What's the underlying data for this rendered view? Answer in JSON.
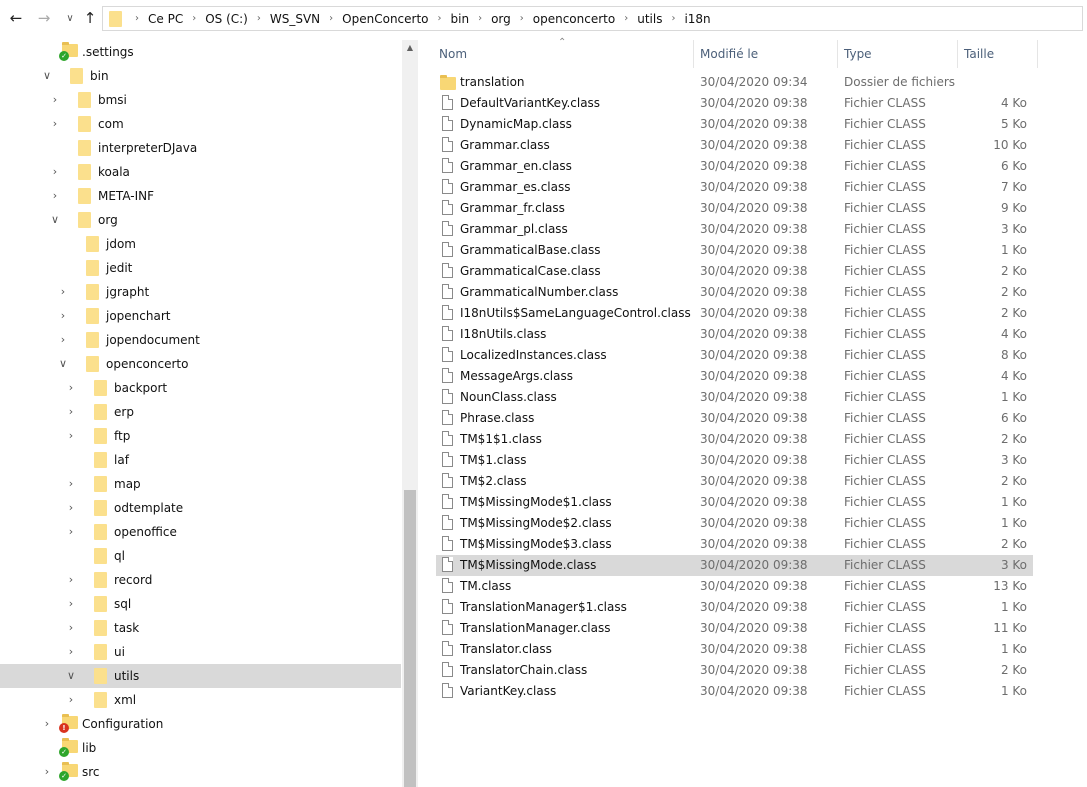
{
  "address": {
    "crumbs": [
      "Ce PC",
      "OS (C:)",
      "WS_SVN",
      "OpenConcerto",
      "bin",
      "org",
      "openconcerto",
      "utils",
      "i18n"
    ]
  },
  "columns": {
    "name": "Nom",
    "date": "Modifié le",
    "type": "Type",
    "size": "Taille"
  },
  "tree": [
    {
      "label": ".settings",
      "level": 0,
      "chevron": "",
      "icon": "folder",
      "badge": "ok"
    },
    {
      "label": "bin",
      "level": 0,
      "chevron": "down",
      "icon": "folder-tall",
      "badge": ""
    },
    {
      "label": "bmsi",
      "level": 1,
      "chevron": "right",
      "icon": "folder-tall",
      "badge": ""
    },
    {
      "label": "com",
      "level": 1,
      "chevron": "right",
      "icon": "folder-tall",
      "badge": ""
    },
    {
      "label": "interpreterDJava",
      "level": 1,
      "chevron": "",
      "icon": "folder-tall",
      "badge": ""
    },
    {
      "label": "koala",
      "level": 1,
      "chevron": "right",
      "icon": "folder-tall",
      "badge": ""
    },
    {
      "label": "META-INF",
      "level": 1,
      "chevron": "right",
      "icon": "folder-tall",
      "badge": ""
    },
    {
      "label": "org",
      "level": 1,
      "chevron": "down",
      "icon": "folder-tall",
      "badge": ""
    },
    {
      "label": "jdom",
      "level": 2,
      "chevron": "",
      "icon": "folder-tall",
      "badge": ""
    },
    {
      "label": "jedit",
      "level": 2,
      "chevron": "",
      "icon": "folder-tall",
      "badge": ""
    },
    {
      "label": "jgrapht",
      "level": 2,
      "chevron": "right",
      "icon": "folder-tall",
      "badge": ""
    },
    {
      "label": "jopenchart",
      "level": 2,
      "chevron": "right",
      "icon": "folder-tall",
      "badge": ""
    },
    {
      "label": "jopendocument",
      "level": 2,
      "chevron": "right",
      "icon": "folder-tall",
      "badge": ""
    },
    {
      "label": "openconcerto",
      "level": 2,
      "chevron": "down",
      "icon": "folder-tall",
      "badge": ""
    },
    {
      "label": "backport",
      "level": 3,
      "chevron": "right",
      "icon": "folder-tall",
      "badge": ""
    },
    {
      "label": "erp",
      "level": 3,
      "chevron": "right",
      "icon": "folder-tall",
      "badge": ""
    },
    {
      "label": "ftp",
      "level": 3,
      "chevron": "right",
      "icon": "folder-tall",
      "badge": ""
    },
    {
      "label": "laf",
      "level": 3,
      "chevron": "",
      "icon": "folder-tall",
      "badge": ""
    },
    {
      "label": "map",
      "level": 3,
      "chevron": "right",
      "icon": "folder-tall",
      "badge": ""
    },
    {
      "label": "odtemplate",
      "level": 3,
      "chevron": "right",
      "icon": "folder-tall",
      "badge": ""
    },
    {
      "label": "openoffice",
      "level": 3,
      "chevron": "right",
      "icon": "folder-tall",
      "badge": ""
    },
    {
      "label": "ql",
      "level": 3,
      "chevron": "",
      "icon": "folder-tall",
      "badge": ""
    },
    {
      "label": "record",
      "level": 3,
      "chevron": "right",
      "icon": "folder-tall",
      "badge": ""
    },
    {
      "label": "sql",
      "level": 3,
      "chevron": "right",
      "icon": "folder-tall",
      "badge": ""
    },
    {
      "label": "task",
      "level": 3,
      "chevron": "right",
      "icon": "folder-tall",
      "badge": ""
    },
    {
      "label": "ui",
      "level": 3,
      "chevron": "right",
      "icon": "folder-tall",
      "badge": ""
    },
    {
      "label": "utils",
      "level": 3,
      "chevron": "down",
      "icon": "folder-tall",
      "badge": "",
      "selected": true
    },
    {
      "label": "xml",
      "level": 3,
      "chevron": "right",
      "icon": "folder-tall",
      "badge": ""
    },
    {
      "label": "Configuration",
      "level": 0,
      "chevron": "right",
      "icon": "folder",
      "badge": "err"
    },
    {
      "label": "lib",
      "level": 0,
      "chevron": "",
      "icon": "folder",
      "badge": "ok"
    },
    {
      "label": "src",
      "level": 0,
      "chevron": "right",
      "icon": "folder",
      "badge": "ok"
    }
  ],
  "files": [
    {
      "name": "translation",
      "date": "30/04/2020 09:34",
      "type": "Dossier de fichiers",
      "size": "",
      "kind": "folder"
    },
    {
      "name": "DefaultVariantKey.class",
      "date": "30/04/2020 09:38",
      "type": "Fichier CLASS",
      "size": "4 Ko",
      "kind": "file"
    },
    {
      "name": "DynamicMap.class",
      "date": "30/04/2020 09:38",
      "type": "Fichier CLASS",
      "size": "5 Ko",
      "kind": "file"
    },
    {
      "name": "Grammar.class",
      "date": "30/04/2020 09:38",
      "type": "Fichier CLASS",
      "size": "10 Ko",
      "kind": "file"
    },
    {
      "name": "Grammar_en.class",
      "date": "30/04/2020 09:38",
      "type": "Fichier CLASS",
      "size": "6 Ko",
      "kind": "file"
    },
    {
      "name": "Grammar_es.class",
      "date": "30/04/2020 09:38",
      "type": "Fichier CLASS",
      "size": "7 Ko",
      "kind": "file"
    },
    {
      "name": "Grammar_fr.class",
      "date": "30/04/2020 09:38",
      "type": "Fichier CLASS",
      "size": "9 Ko",
      "kind": "file"
    },
    {
      "name": "Grammar_pl.class",
      "date": "30/04/2020 09:38",
      "type": "Fichier CLASS",
      "size": "3 Ko",
      "kind": "file"
    },
    {
      "name": "GrammaticalBase.class",
      "date": "30/04/2020 09:38",
      "type": "Fichier CLASS",
      "size": "1 Ko",
      "kind": "file"
    },
    {
      "name": "GrammaticalCase.class",
      "date": "30/04/2020 09:38",
      "type": "Fichier CLASS",
      "size": "2 Ko",
      "kind": "file"
    },
    {
      "name": "GrammaticalNumber.class",
      "date": "30/04/2020 09:38",
      "type": "Fichier CLASS",
      "size": "2 Ko",
      "kind": "file"
    },
    {
      "name": "I18nUtils$SameLanguageControl.class",
      "date": "30/04/2020 09:38",
      "type": "Fichier CLASS",
      "size": "2 Ko",
      "kind": "file"
    },
    {
      "name": "I18nUtils.class",
      "date": "30/04/2020 09:38",
      "type": "Fichier CLASS",
      "size": "4 Ko",
      "kind": "file"
    },
    {
      "name": "LocalizedInstances.class",
      "date": "30/04/2020 09:38",
      "type": "Fichier CLASS",
      "size": "8 Ko",
      "kind": "file"
    },
    {
      "name": "MessageArgs.class",
      "date": "30/04/2020 09:38",
      "type": "Fichier CLASS",
      "size": "4 Ko",
      "kind": "file"
    },
    {
      "name": "NounClass.class",
      "date": "30/04/2020 09:38",
      "type": "Fichier CLASS",
      "size": "1 Ko",
      "kind": "file"
    },
    {
      "name": "Phrase.class",
      "date": "30/04/2020 09:38",
      "type": "Fichier CLASS",
      "size": "6 Ko",
      "kind": "file"
    },
    {
      "name": "TM$1$1.class",
      "date": "30/04/2020 09:38",
      "type": "Fichier CLASS",
      "size": "2 Ko",
      "kind": "file"
    },
    {
      "name": "TM$1.class",
      "date": "30/04/2020 09:38",
      "type": "Fichier CLASS",
      "size": "3 Ko",
      "kind": "file"
    },
    {
      "name": "TM$2.class",
      "date": "30/04/2020 09:38",
      "type": "Fichier CLASS",
      "size": "2 Ko",
      "kind": "file"
    },
    {
      "name": "TM$MissingMode$1.class",
      "date": "30/04/2020 09:38",
      "type": "Fichier CLASS",
      "size": "1 Ko",
      "kind": "file"
    },
    {
      "name": "TM$MissingMode$2.class",
      "date": "30/04/2020 09:38",
      "type": "Fichier CLASS",
      "size": "1 Ko",
      "kind": "file"
    },
    {
      "name": "TM$MissingMode$3.class",
      "date": "30/04/2020 09:38",
      "type": "Fichier CLASS",
      "size": "2 Ko",
      "kind": "file"
    },
    {
      "name": "TM$MissingMode.class",
      "date": "30/04/2020 09:38",
      "type": "Fichier CLASS",
      "size": "3 Ko",
      "kind": "file",
      "selected": true
    },
    {
      "name": "TM.class",
      "date": "30/04/2020 09:38",
      "type": "Fichier CLASS",
      "size": "13 Ko",
      "kind": "file"
    },
    {
      "name": "TranslationManager$1.class",
      "date": "30/04/2020 09:38",
      "type": "Fichier CLASS",
      "size": "1 Ko",
      "kind": "file"
    },
    {
      "name": "TranslationManager.class",
      "date": "30/04/2020 09:38",
      "type": "Fichier CLASS",
      "size": "11 Ko",
      "kind": "file"
    },
    {
      "name": "Translator.class",
      "date": "30/04/2020 09:38",
      "type": "Fichier CLASS",
      "size": "1 Ko",
      "kind": "file"
    },
    {
      "name": "TranslatorChain.class",
      "date": "30/04/2020 09:38",
      "type": "Fichier CLASS",
      "size": "2 Ko",
      "kind": "file"
    },
    {
      "name": "VariantKey.class",
      "date": "30/04/2020 09:38",
      "type": "Fichier CLASS",
      "size": "1 Ko",
      "kind": "file"
    }
  ],
  "icons": {
    "back": "arrow-left-icon",
    "forward": "arrow-right-icon",
    "history": "chevron-down-icon",
    "up": "arrow-up-icon",
    "folder": "folder-icon",
    "file": "file-icon"
  },
  "colors": {
    "selection": "#d9d9d9",
    "folder": "#f8d775",
    "header_text": "#4c607a"
  }
}
